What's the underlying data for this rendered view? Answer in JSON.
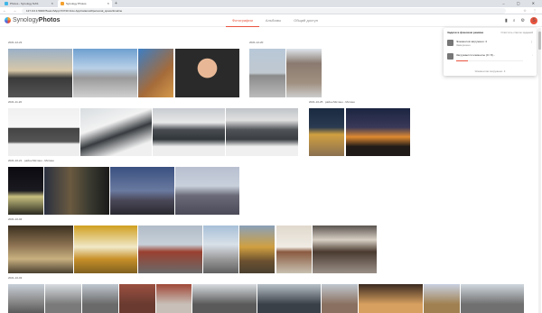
{
  "browser": {
    "tabs": [
      {
        "title": "Photos - Synology NAS",
        "icon_color": "#3fb6e8"
      },
      {
        "title": "Synology Photos",
        "icon_color": "#f3a12f"
      }
    ],
    "new_tab": "+",
    "window_controls": "– ▢ ✕",
    "url": "127.0.0.1:5000/?launchApp=SYNO.Foto.AppInstance#/personal_space/timeline",
    "nav_icons": "← → ↻",
    "addr_icons": "☆ ⋮"
  },
  "app": {
    "logo_light": "Synology",
    "logo_bold": "Photos",
    "tabs": [
      "Фотографии",
      "Альбомы",
      "Общий доступ"
    ],
    "active_tab": 0,
    "icons": {
      "upload": "▮",
      "search": "⌕",
      "settings": "⚙"
    },
    "avatar_letter": "S",
    "accent_color": "#e8543f"
  },
  "sections": [
    {
      "label": "2021-12-22"
    },
    {
      "label": "2021-12-20"
    },
    {
      "label": "2021-11-20"
    },
    {
      "label": "2021-10-25 · район Митино - Митино"
    },
    {
      "label": "2021-10-21 · район Митино - Митино"
    },
    {
      "label": "2021-10-04"
    },
    {
      "label": "2021-10-03"
    }
  ],
  "panel": {
    "title": "Задачи в фоновом режиме",
    "clear": "Очистить список заданий",
    "task1": {
      "title": "Элементов загружено: 4",
      "status": "Завершено"
    },
    "task2": {
      "title": "Загружается элементы (0 / 8)...",
      "status": "",
      "progress": 0.18
    },
    "footer": "Элементов загружено: 4",
    "more_icon": "⋮"
  }
}
